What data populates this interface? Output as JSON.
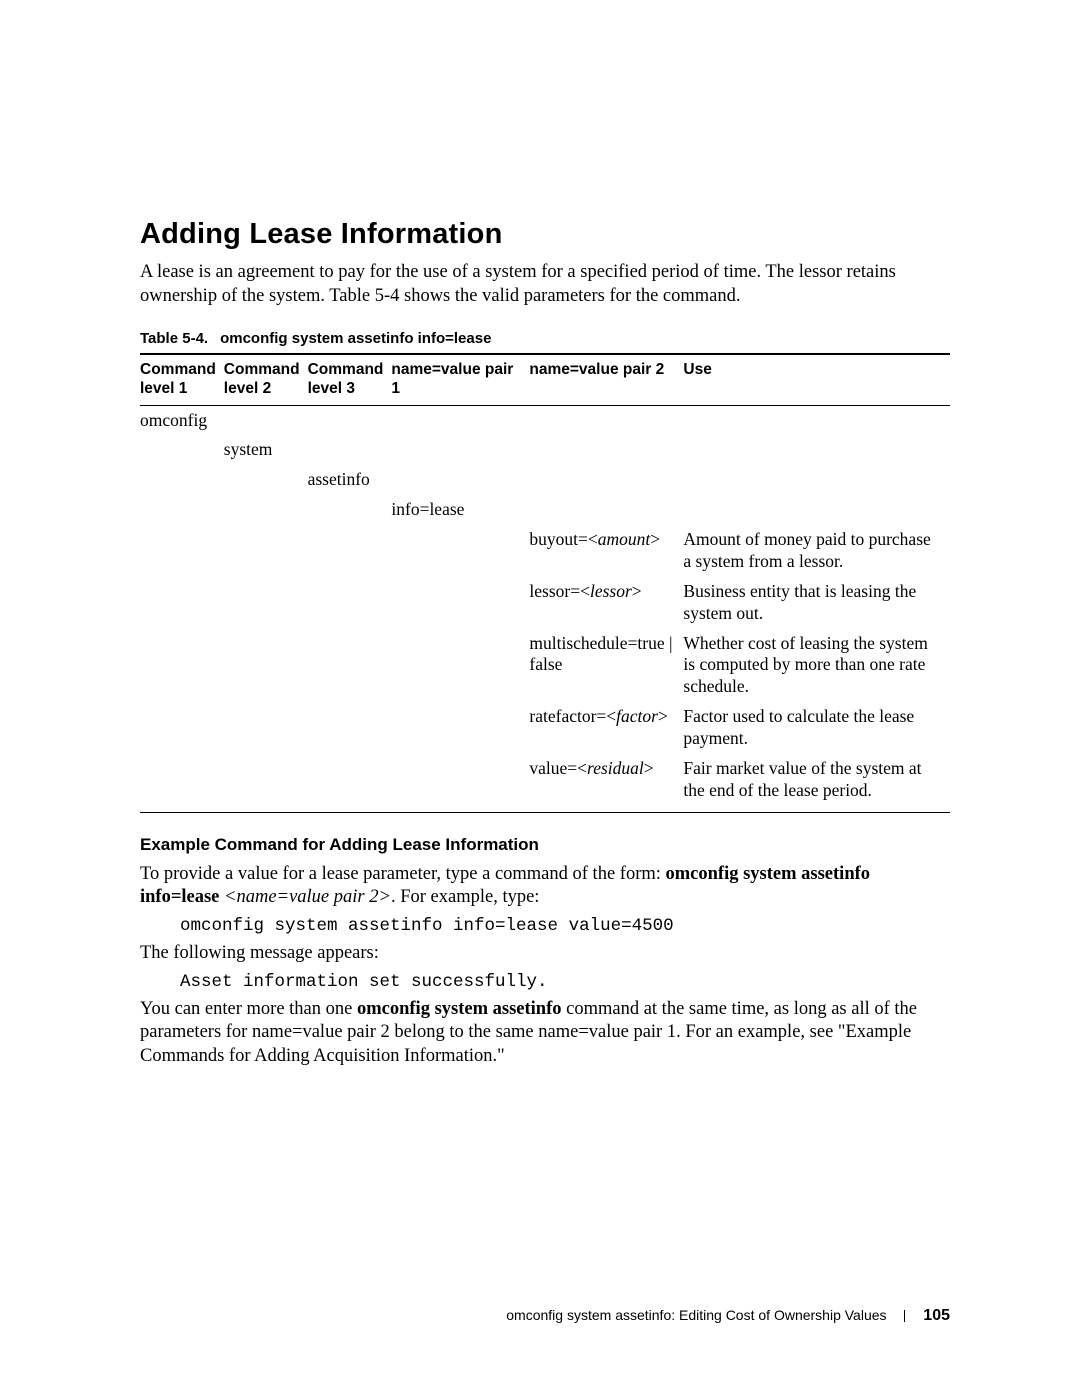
{
  "section": {
    "title": "Adding Lease Information",
    "intro_a": "A lease is an agreement to pay for the use of a system for a specified period of time. The lessor retains ownership of the system. ",
    "intro_link": "Table 5-4",
    "intro_b": " shows the valid parameters for the command."
  },
  "table": {
    "caption_label": "Table 5-4.",
    "caption_text": "omconfig system assetinfo info=lease",
    "headers": {
      "c1a": "Command",
      "c1b": "level 1",
      "c2a": "Command",
      "c2b": "level 2",
      "c3a": "Command",
      "c3b": "level 3",
      "c4": "name=value pair 1",
      "c5": "name=value pair 2",
      "c6": "Use"
    },
    "rows": {
      "r1c1": "omconfig",
      "r2c2": "system",
      "r3c3": "assetinfo",
      "r4c4": "info=lease",
      "r5pair_a": "buyout=<",
      "r5pair_i": "amount",
      "r5pair_b": ">",
      "r5use": "Amount of money paid to purchase a system from a lessor.",
      "r6pair_a": "lessor=<",
      "r6pair_i": "lessor",
      "r6pair_b": ">",
      "r6use": "Business entity that is leasing the system out.",
      "r7pair": "multischedule=true | false",
      "r7use": "Whether cost of leasing the system is computed by more than one rate schedule.",
      "r8pair_a": "ratefactor=<",
      "r8pair_i": "factor",
      "r8pair_b": ">",
      "r8use": "Factor used to calculate the lease payment.",
      "r9pair_a": "value=<",
      "r9pair_i": "residual",
      "r9pair_b": ">",
      "r9use": "Fair market value of the system at the end of the lease period."
    }
  },
  "example": {
    "heading": "Example Command for Adding Lease Information",
    "p1_a": "To provide a value for a lease parameter, type a command of the form: ",
    "p1_bold": "omconfig system assetinfo info=lease ",
    "p1_italic": "<name=value pair 2>",
    "p1_c": ". For example, type:",
    "code1": "omconfig system assetinfo info=lease value=4500",
    "p2": "The following message appears:",
    "code2": "Asset information set successfully.",
    "p3_a": "You can enter more than one ",
    "p3_bold": "omconfig system assetinfo",
    "p3_b": " command at the same time, as long as all of the parameters for name=value pair 2 belong to the same name=value pair 1. For an example, see \"Example Commands for Adding Acquisition Information.\""
  },
  "footer": {
    "text": "omconfig system assetinfo: Editing Cost of Ownership Values",
    "page": "105"
  }
}
